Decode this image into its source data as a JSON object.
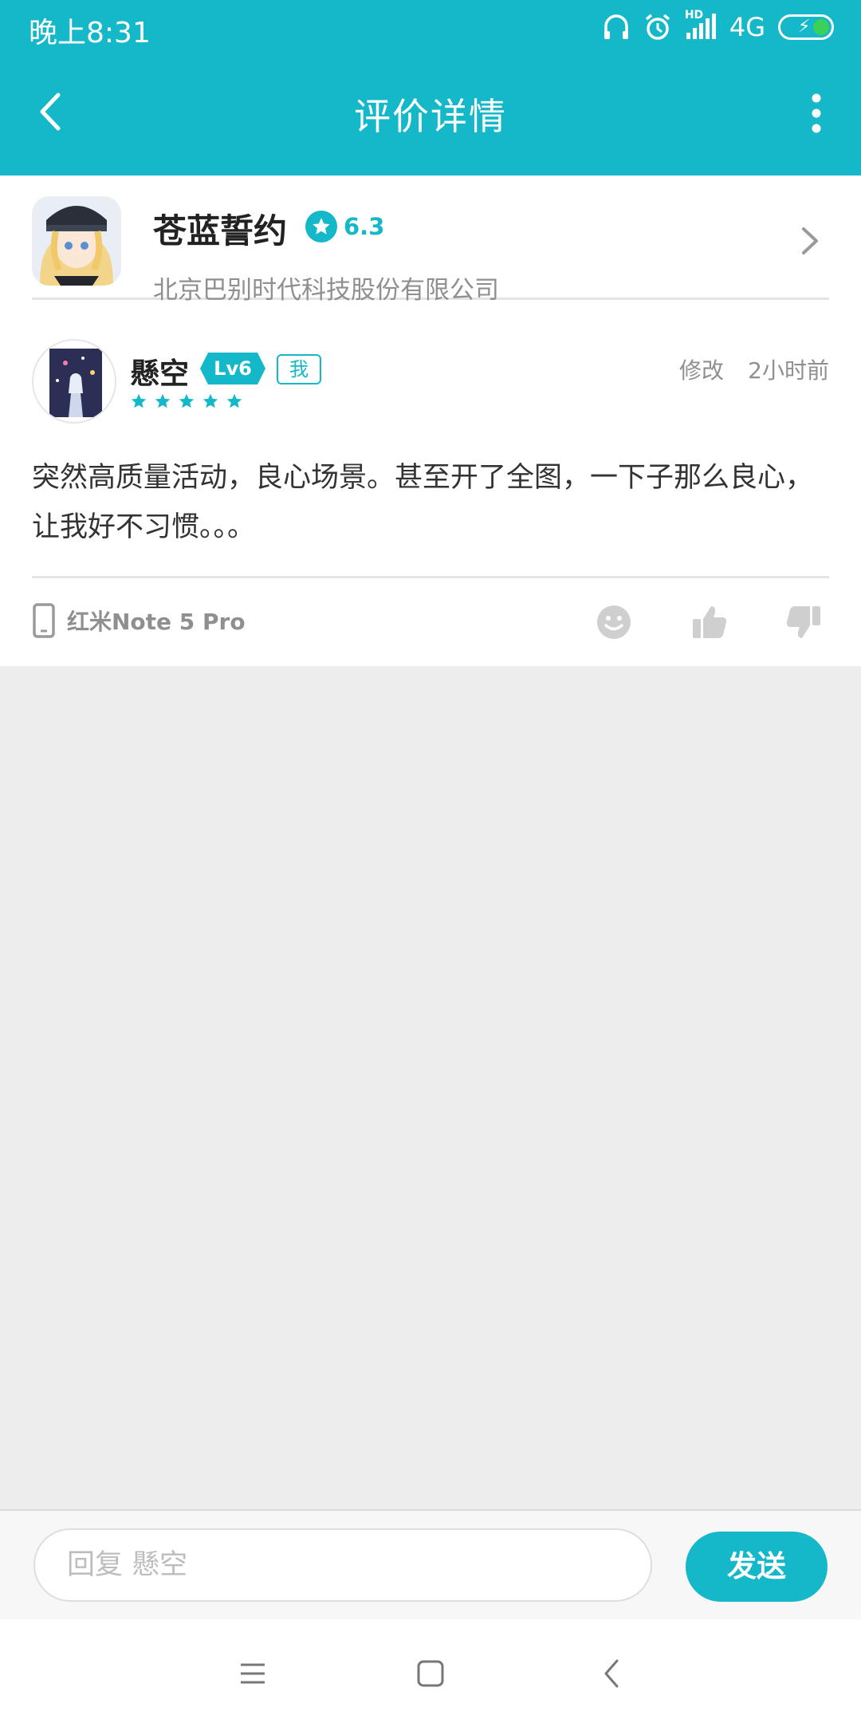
{
  "status_bar": {
    "time": "晚上8:31",
    "network": "4G",
    "hd_label": "HD"
  },
  "header": {
    "title": "评价详情",
    "back_icon": "chevron-left-icon",
    "more_icon": "more-vertical-icon",
    "background_color": "#14b8c9"
  },
  "app": {
    "name": "苍蓝誓约",
    "rating": "6.3",
    "developer": "北京巴别时代科技股份有限公司"
  },
  "review": {
    "username": "懸空",
    "level": "Lv6",
    "me_tag": "我",
    "stars": 5,
    "edit_label": "修改",
    "time_ago": "2小时前",
    "text": "突然高质量活动，良心场景。甚至开了全图，一下子那么良心，让我好不习惯。。。",
    "device": "红米Note 5 Pro"
  },
  "reply": {
    "placeholder": "回复 懸空",
    "value": "",
    "send_label": "发送"
  },
  "accent_color": "#14b8c9"
}
